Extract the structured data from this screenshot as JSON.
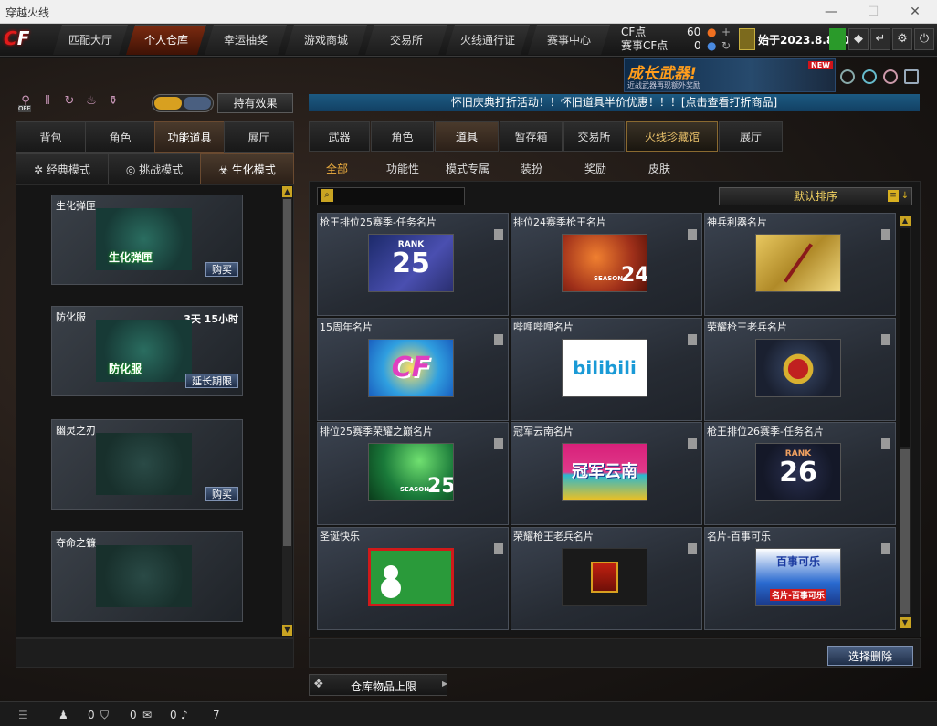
{
  "window": {
    "title": "穿越火线",
    "min": "—",
    "max": "☐",
    "close": "✕"
  },
  "logo": "CF",
  "nav": [
    "匹配大厅",
    "个人仓库",
    "幸运抽奖",
    "游戏商城",
    "交易所",
    "火线通行证",
    "赛事中心"
  ],
  "currency": {
    "cf_label": "CF点",
    "cf_value": "60",
    "cf_plus": "+",
    "match_label": "赛事CF点",
    "match_value": "0"
  },
  "expire": "始于2023.8.800",
  "banner": {
    "title": "成长武器!",
    "subtitle": "近战武器再现额外奖励",
    "badge": "NEW"
  },
  "left": {
    "toggle_off": "OFF",
    "effect_button": "持有效果",
    "tabs": [
      "背包",
      "角色",
      "功能道具",
      "展厅"
    ],
    "modes": [
      "经典模式",
      "挑战模式",
      "生化模式"
    ],
    "items": [
      {
        "name": "生化弹匣",
        "art": "生化弹匣",
        "time": "",
        "action": "购买"
      },
      {
        "name": "防化服",
        "art": "防化服",
        "time": "3天 15小时",
        "action": "延长期限"
      },
      {
        "name": "幽灵之刃",
        "art": "",
        "time": "",
        "action": "购买"
      },
      {
        "name": "夺命之镰",
        "art": "",
        "time": "",
        "action": ""
      }
    ]
  },
  "notice": "怀旧庆典打折活动！！怀旧道具半价优惠！！！[点击查看打折商品]",
  "right": {
    "tabs": [
      "武器",
      "角色",
      "道具",
      "暂存箱",
      "交易所",
      "火线珍藏馆",
      "展厅"
    ],
    "subtabs": [
      "全部",
      "功能性",
      "模式专属",
      "装扮",
      "奖励",
      "皮肤"
    ],
    "sort": "默认排序",
    "cards": [
      {
        "name": "枪王排位25赛季-任务名片",
        "art": "25",
        "art2": "RANK"
      },
      {
        "name": "排位24赛季枪王名片",
        "art": "24",
        "art2": "SEASON"
      },
      {
        "name": "神兵利器名片",
        "art": "",
        "art2": ""
      },
      {
        "name": "15周年名片",
        "art": "CF",
        "art2": ""
      },
      {
        "name": "哔哩哔哩名片",
        "art": "bilibili",
        "art2": ""
      },
      {
        "name": "荣耀枪王老兵名片",
        "art": "",
        "art2": ""
      },
      {
        "name": "排位25赛季荣耀之巅名片",
        "art": "25",
        "art2": "SEASON"
      },
      {
        "name": "冠军云南名片",
        "art": "冠军云南",
        "art2": ""
      },
      {
        "name": "枪王排位26赛季-任务名片",
        "art": "26",
        "art2": "RANK"
      },
      {
        "name": "圣诞快乐",
        "art": "",
        "art2": ""
      },
      {
        "name": "荣耀枪王老兵名片",
        "art": "",
        "art2": ""
      },
      {
        "name": "名片-百事可乐",
        "art": "百事可乐",
        "art2": "名片-百事可乐"
      }
    ],
    "delete_selected": "选择删除",
    "capacity": "仓库物品上限"
  },
  "status": {
    "a": "0",
    "b": "0",
    "c": "0",
    "d": "7"
  }
}
